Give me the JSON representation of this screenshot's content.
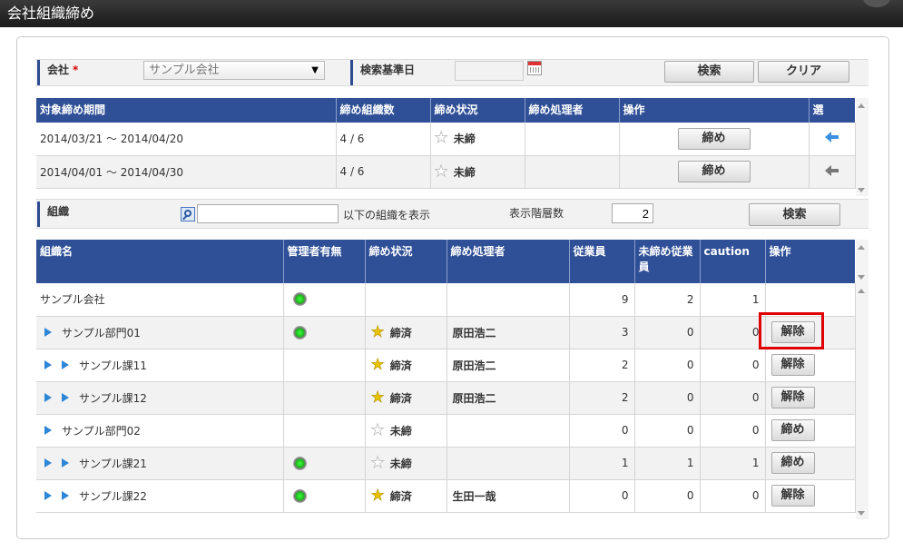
{
  "title": "会社組織締め",
  "search": {
    "company_label": "会社",
    "required_mark": "*",
    "company_value": "サンプル会社",
    "base_date_label": "検索基準日",
    "base_date_value": "",
    "search_button": "検索",
    "clear_button": "クリア"
  },
  "period_table": {
    "headers": [
      "対象締め期間",
      "締め組織数",
      "締め状況",
      "締め処理者",
      "操作",
      "選"
    ],
    "rows": [
      {
        "period": "2014/03/21 ～ 2014/04/20",
        "count": "4 / 6",
        "status": "未締",
        "status_star": "off",
        "processor": "",
        "action": "締め",
        "select_icon": "arrow-left-icon-blue"
      },
      {
        "period": "2014/04/01 ～ 2014/04/30",
        "count": "4 / 6",
        "status": "未締",
        "status_star": "off",
        "processor": "",
        "action": "締め",
        "select_icon": "arrow-left-icon-gray"
      }
    ]
  },
  "org_filter": {
    "label": "組織",
    "input_value": "",
    "suffix_text": "以下の組織を表示",
    "levels_label": "表示階層数",
    "levels_value": "2",
    "search_button": "検索"
  },
  "org_table": {
    "headers": [
      "組織名",
      "管理者有無",
      "締め状況",
      "締め処理者",
      "従業員",
      "未締め従業員",
      "caution",
      "操作"
    ],
    "rows": [
      {
        "indent": 0,
        "name": "サンプル会社",
        "manager": true,
        "status": "",
        "star": "",
        "processor": "",
        "employees": "9",
        "unclosed": "2",
        "caution": "1",
        "action": ""
      },
      {
        "indent": 1,
        "name": "サンプル部門01",
        "manager": true,
        "status": "締済",
        "star": "on",
        "processor": "原田浩二",
        "employees": "3",
        "unclosed": "0",
        "caution": "0",
        "action": "解除"
      },
      {
        "indent": 2,
        "name": "サンプル課11",
        "manager": false,
        "status": "締済",
        "star": "on",
        "processor": "原田浩二",
        "employees": "2",
        "unclosed": "0",
        "caution": "0",
        "action": "解除"
      },
      {
        "indent": 2,
        "name": "サンプル課12",
        "manager": false,
        "status": "締済",
        "star": "on",
        "processor": "原田浩二",
        "employees": "2",
        "unclosed": "0",
        "caution": "0",
        "action": "解除"
      },
      {
        "indent": 1,
        "name": "サンプル部門02",
        "manager": false,
        "status": "未締",
        "star": "off",
        "processor": "",
        "employees": "0",
        "unclosed": "0",
        "caution": "0",
        "action": "締め"
      },
      {
        "indent": 2,
        "name": "サンプル課21",
        "manager": true,
        "status": "未締",
        "star": "off",
        "processor": "",
        "employees": "1",
        "unclosed": "1",
        "caution": "1",
        "action": "締め"
      },
      {
        "indent": 2,
        "name": "サンプル課22",
        "manager": true,
        "status": "締済",
        "star": "on",
        "processor": "生田一哉",
        "employees": "0",
        "unclosed": "0",
        "caution": "0",
        "action": "解除"
      }
    ]
  },
  "colors": {
    "header_blue": "#2f4f97",
    "highlight_red": "#e00000",
    "led_green": "#1db31d",
    "star_yellow": "#e8c200"
  }
}
